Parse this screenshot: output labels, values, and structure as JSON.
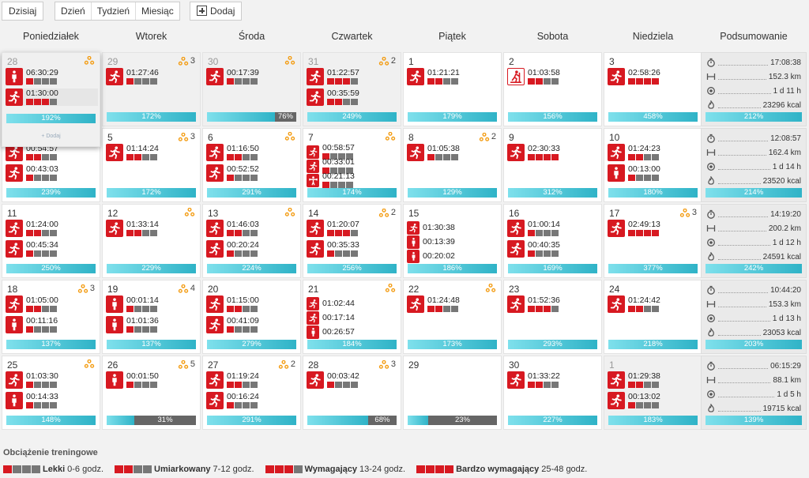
{
  "toolbar": {
    "today": "Dzisiaj",
    "day": "Dzień",
    "week": "Tydzień",
    "month": "Miesiąc",
    "add": "Dodaj"
  },
  "columns": [
    "Poniedziałek",
    "Wtorek",
    "Środa",
    "Czwartek",
    "Piątek",
    "Sobota",
    "Niedziela",
    "Podsumowanie"
  ],
  "colors": {
    "accent_red": "#d71921",
    "progress_cyan": "#2fb3c7",
    "load_gray": "#777777"
  },
  "weeks": [
    {
      "days": [
        {
          "day": "28",
          "other_month": true,
          "hover": true,
          "badge": "",
          "more": "+ Dodaj",
          "activities": [
            {
              "icon": "standing-icon",
              "time": "06:30:29",
              "load": 1,
              "highlight": false
            },
            {
              "icon": "running-icon",
              "time": "01:30:00",
              "load": 3,
              "highlight": true
            }
          ],
          "percent": "192%",
          "fill": 1.0
        },
        {
          "day": "29",
          "other_month": true,
          "badge": "3",
          "activities": [
            {
              "icon": "running-icon",
              "time": "01:27:46",
              "load": 1
            }
          ],
          "percent": "172%",
          "fill": 1.0
        },
        {
          "day": "30",
          "other_month": true,
          "badge": "",
          "activities": [
            {
              "icon": "running-icon",
              "time": "00:17:39",
              "load": 1
            }
          ],
          "percent": "76%",
          "fill": 0.76
        },
        {
          "day": "31",
          "other_month": true,
          "badge": "2",
          "activities": [
            {
              "icon": "running-icon",
              "time": "01:22:57",
              "load": 3
            },
            {
              "icon": "running-icon",
              "time": "00:35:59",
              "load": 2
            }
          ],
          "percent": "249%",
          "fill": 1.0
        },
        {
          "day": "1",
          "badge": null,
          "activities": [
            {
              "icon": "running-icon",
              "time": "01:21:21",
              "load": 2
            }
          ],
          "percent": "179%",
          "fill": 1.0
        },
        {
          "day": "2",
          "badge": null,
          "activities": [
            {
              "icon": "skiing-icon",
              "time": "01:03:58",
              "load": 2,
              "outline": true
            }
          ],
          "percent": "156%",
          "fill": 1.0
        },
        {
          "day": "3",
          "badge": null,
          "activities": [
            {
              "icon": "running-icon",
              "time": "02:58:26",
              "load": 4
            }
          ],
          "percent": "458%",
          "fill": 1.0
        }
      ],
      "summary": {
        "time": "17:08:38",
        "distance": "152.3 km",
        "recovery": "1 d 11 h",
        "calories": "23296 kcal",
        "percent": "212%"
      }
    },
    {
      "days": [
        {
          "day": "4",
          "badge": null,
          "hidden_day": true,
          "activities": [
            {
              "icon": "running-icon",
              "time": "00:54:57",
              "load": 2
            },
            {
              "icon": "running-icon",
              "time": "00:43:03",
              "load": 1
            }
          ],
          "percent": "239%",
          "fill": 1.0
        },
        {
          "day": "5",
          "badge": "3",
          "activities": [
            {
              "icon": "running-icon",
              "time": "01:14:24",
              "load": 2
            }
          ],
          "percent": "172%",
          "fill": 1.0
        },
        {
          "day": "6",
          "badge": "",
          "activities": [
            {
              "icon": "running-icon",
              "time": "01:16:50",
              "load": 2
            },
            {
              "icon": "running-icon",
              "time": "00:52:52",
              "load": 1
            }
          ],
          "percent": "291%",
          "fill": 1.0
        },
        {
          "day": "7",
          "badge": "",
          "activities": [
            {
              "icon": "running-icon",
              "time": "00:58:57",
              "load": 1,
              "small": true
            },
            {
              "icon": "running-icon",
              "time": "00:33:01",
              "load": 1,
              "small": true
            },
            {
              "icon": "strength-icon",
              "time": "00:21:13",
              "load": 1,
              "small": true
            }
          ],
          "percent": "174%",
          "fill": 1.0
        },
        {
          "day": "8",
          "badge": "2",
          "activities": [
            {
              "icon": "running-icon",
              "time": "01:05:38",
              "load": 1
            }
          ],
          "percent": "129%",
          "fill": 1.0
        },
        {
          "day": "9",
          "badge": null,
          "activities": [
            {
              "icon": "running-icon",
              "time": "02:30:33",
              "load": 4
            }
          ],
          "percent": "312%",
          "fill": 1.0
        },
        {
          "day": "10",
          "badge": null,
          "activities": [
            {
              "icon": "running-icon",
              "time": "01:24:23",
              "load": 2
            },
            {
              "icon": "standing-icon",
              "time": "00:13:00",
              "load": 1
            }
          ],
          "percent": "180%",
          "fill": 1.0
        }
      ],
      "summary": {
        "time": "12:08:57",
        "distance": "162.4 km",
        "recovery": "1 d 14 h",
        "calories": "23520 kcal",
        "percent": "214%"
      }
    },
    {
      "days": [
        {
          "day": "11",
          "badge": null,
          "activities": [
            {
              "icon": "running-icon",
              "time": "01:24:00",
              "load": 2
            },
            {
              "icon": "running-icon",
              "time": "00:45:34",
              "load": 1
            }
          ],
          "percent": "250%",
          "fill": 1.0
        },
        {
          "day": "12",
          "badge": "",
          "activities": [
            {
              "icon": "running-icon",
              "time": "01:33:14",
              "load": 2
            }
          ],
          "percent": "229%",
          "fill": 1.0
        },
        {
          "day": "13",
          "badge": "",
          "activities": [
            {
              "icon": "running-icon",
              "time": "01:46:03",
              "load": 2
            },
            {
              "icon": "running-icon",
              "time": "00:20:24",
              "load": 1
            }
          ],
          "percent": "224%",
          "fill": 1.0
        },
        {
          "day": "14",
          "badge": "2",
          "activities": [
            {
              "icon": "running-icon",
              "time": "01:20:07",
              "load": 3
            },
            {
              "icon": "running-icon",
              "time": "00:35:33",
              "load": 1
            }
          ],
          "percent": "256%",
          "fill": 1.0
        },
        {
          "day": "15",
          "badge": null,
          "activities": [
            {
              "icon": "running-icon",
              "time": "01:30:38",
              "load": 0,
              "small": true
            },
            {
              "icon": "standing-icon",
              "time": "00:13:39",
              "load": 0,
              "small": true
            },
            {
              "icon": "standing-icon",
              "time": "00:20:02",
              "load": 0,
              "small": true
            }
          ],
          "percent": "186%",
          "fill": 1.0
        },
        {
          "day": "16",
          "badge": null,
          "activities": [
            {
              "icon": "running-icon",
              "time": "01:00:14",
              "load": 1
            },
            {
              "icon": "running-icon",
              "time": "00:40:35",
              "load": 1
            }
          ],
          "percent": "169%",
          "fill": 1.0
        },
        {
          "day": "17",
          "badge": "3",
          "activities": [
            {
              "icon": "running-icon",
              "time": "02:49:13",
              "load": 4
            }
          ],
          "percent": "377%",
          "fill": 1.0
        }
      ],
      "summary": {
        "time": "14:19:20",
        "distance": "200.2 km",
        "recovery": "1 d 12 h",
        "calories": "24591 kcal",
        "percent": "242%"
      }
    },
    {
      "days": [
        {
          "day": "18",
          "badge": "3",
          "activities": [
            {
              "icon": "running-icon",
              "time": "01:05:00",
              "load": 2
            },
            {
              "icon": "standing-icon",
              "time": "00:11:16",
              "load": 1
            }
          ],
          "percent": "137%",
          "fill": 1.0
        },
        {
          "day": "19",
          "badge": "4",
          "activities": [
            {
              "icon": "standing-icon",
              "time": "00:01:14",
              "load": 1
            },
            {
              "icon": "standing-icon",
              "time": "01:01:36",
              "load": 1
            }
          ],
          "percent": "137%",
          "fill": 1.0
        },
        {
          "day": "20",
          "badge": null,
          "activities": [
            {
              "icon": "running-icon",
              "time": "01:15:00",
              "load": 2
            },
            {
              "icon": "running-icon",
              "time": "00:41:09",
              "load": 1
            }
          ],
          "percent": "279%",
          "fill": 1.0
        },
        {
          "day": "21",
          "badge": "",
          "activities": [
            {
              "icon": "running-icon",
              "time": "01:02:44",
              "load": 0,
              "small": true
            },
            {
              "icon": "running-icon",
              "time": "00:17:14",
              "load": 0,
              "small": true
            },
            {
              "icon": "standing-icon",
              "time": "00:26:57",
              "load": 0,
              "small": true
            }
          ],
          "percent": "184%",
          "fill": 1.0
        },
        {
          "day": "22",
          "badge": "",
          "activities": [
            {
              "icon": "running-icon",
              "time": "01:24:48",
              "load": 2
            }
          ],
          "percent": "173%",
          "fill": 1.0
        },
        {
          "day": "23",
          "badge": null,
          "activities": [
            {
              "icon": "running-icon",
              "time": "01:52:36",
              "load": 3
            }
          ],
          "percent": "293%",
          "fill": 1.0
        },
        {
          "day": "24",
          "badge": null,
          "activities": [
            {
              "icon": "running-icon",
              "time": "01:24:42",
              "load": 2
            }
          ],
          "percent": "218%",
          "fill": 1.0
        }
      ],
      "summary": {
        "time": "10:44:20",
        "distance": "153.3 km",
        "recovery": "1 d 13 h",
        "calories": "23053 kcal",
        "percent": "203%"
      }
    },
    {
      "days": [
        {
          "day": "25",
          "badge": "",
          "activities": [
            {
              "icon": "running-icon",
              "time": "01:03:30",
              "load": 1
            },
            {
              "icon": "standing-icon",
              "time": "00:14:33",
              "load": 1
            }
          ],
          "percent": "148%",
          "fill": 1.0
        },
        {
          "day": "26",
          "badge": "5",
          "activities": [
            {
              "icon": "standing-icon",
              "time": "00:01:50",
              "load": 1
            }
          ],
          "percent": "31%",
          "fill": 0.31
        },
        {
          "day": "27",
          "badge": "2",
          "activities": [
            {
              "icon": "running-icon",
              "time": "01:19:24",
              "load": 2
            },
            {
              "icon": "running-icon",
              "time": "00:16:24",
              "load": 1
            }
          ],
          "percent": "291%",
          "fill": 1.0
        },
        {
          "day": "28",
          "badge": "3",
          "activities": [
            {
              "icon": "running-icon",
              "time": "00:03:42",
              "load": 1
            }
          ],
          "percent": "68%",
          "fill": 0.68
        },
        {
          "day": "29",
          "badge": null,
          "activities": [],
          "percent": "23%",
          "fill": 0.23
        },
        {
          "day": "30",
          "badge": null,
          "activities": [
            {
              "icon": "running-icon",
              "time": "01:33:22",
              "load": 2
            }
          ],
          "percent": "227%",
          "fill": 1.0
        },
        {
          "day": "1",
          "other_month": true,
          "badge": null,
          "activities": [
            {
              "icon": "running-icon",
              "time": "01:29:38",
              "load": 2
            },
            {
              "icon": "running-icon",
              "time": "00:13:02",
              "load": 1
            }
          ],
          "percent": "183%",
          "fill": 1.0
        }
      ],
      "summary": {
        "time": "06:15:29",
        "distance": "88.1 km",
        "recovery": "1 d 5 h",
        "calories": "19715 kcal",
        "percent": "139%"
      }
    }
  ],
  "legend": {
    "title": "Obciążenie treningowe",
    "items": [
      {
        "name": "Lekki",
        "range": "0-6 godz.",
        "load": 1
      },
      {
        "name": "Umiarkowany",
        "range": "7-12 godz.",
        "load": 2
      },
      {
        "name": "Wymagający",
        "range": "13-24 godz.",
        "load": 3
      },
      {
        "name": "Bardzo wymagający",
        "range": "25-48 godz.",
        "load": 4
      }
    ]
  }
}
